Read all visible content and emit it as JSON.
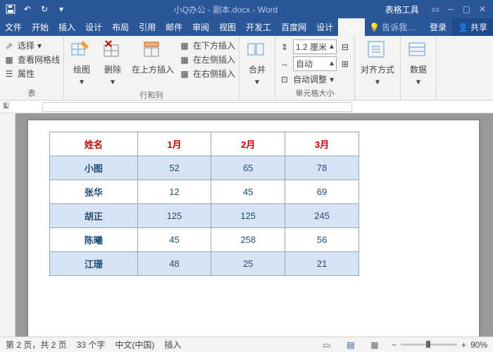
{
  "title": "小Q办公 - 副本.docx - Word",
  "tableTools": "表格工具",
  "tabs": {
    "file": "文件",
    "home": "开始",
    "insert": "插入",
    "design": "设计",
    "layout": "布局",
    "ref": "引用",
    "mail": "邮件",
    "review": "审阅",
    "view": "视图",
    "dev": "开发工",
    "baidu": "百度网",
    "tdesign": "设计",
    "tlayout": "布局"
  },
  "tell": "告诉我…",
  "login": "登录",
  "share": "共享",
  "ribbon": {
    "select": "选择",
    "grid": "查看网格线",
    "props": "属性",
    "tableGroup": "表",
    "draw": "绘图",
    "delete": "删除",
    "insertAbove": "在上方插入",
    "insertBelow": "在下方插入",
    "insertLeft": "在左侧插入",
    "insertRight": "在右侧插入",
    "rowsCols": "行和列",
    "merge": "合并",
    "height": "1.2 厘米",
    "auto": "自动",
    "autoFit": "自动调整",
    "cellSize": "单元格大小",
    "align": "对齐方式",
    "data": "数据"
  },
  "tableHead": [
    "姓名",
    "1月",
    "2月",
    "3月"
  ],
  "tableRows": [
    [
      "小图",
      "52",
      "65",
      "78"
    ],
    [
      "张华",
      "12",
      "45",
      "69"
    ],
    [
      "胡正",
      "125",
      "125",
      "245"
    ],
    [
      "陈曦",
      "45",
      "258",
      "56"
    ],
    [
      "江珊",
      "48",
      "25",
      "21"
    ]
  ],
  "status": {
    "page": "第 2 页，共 2 页",
    "words": "33 个字",
    "lang": "中文(中国)",
    "insert": "插入",
    "zoom": "90%"
  }
}
